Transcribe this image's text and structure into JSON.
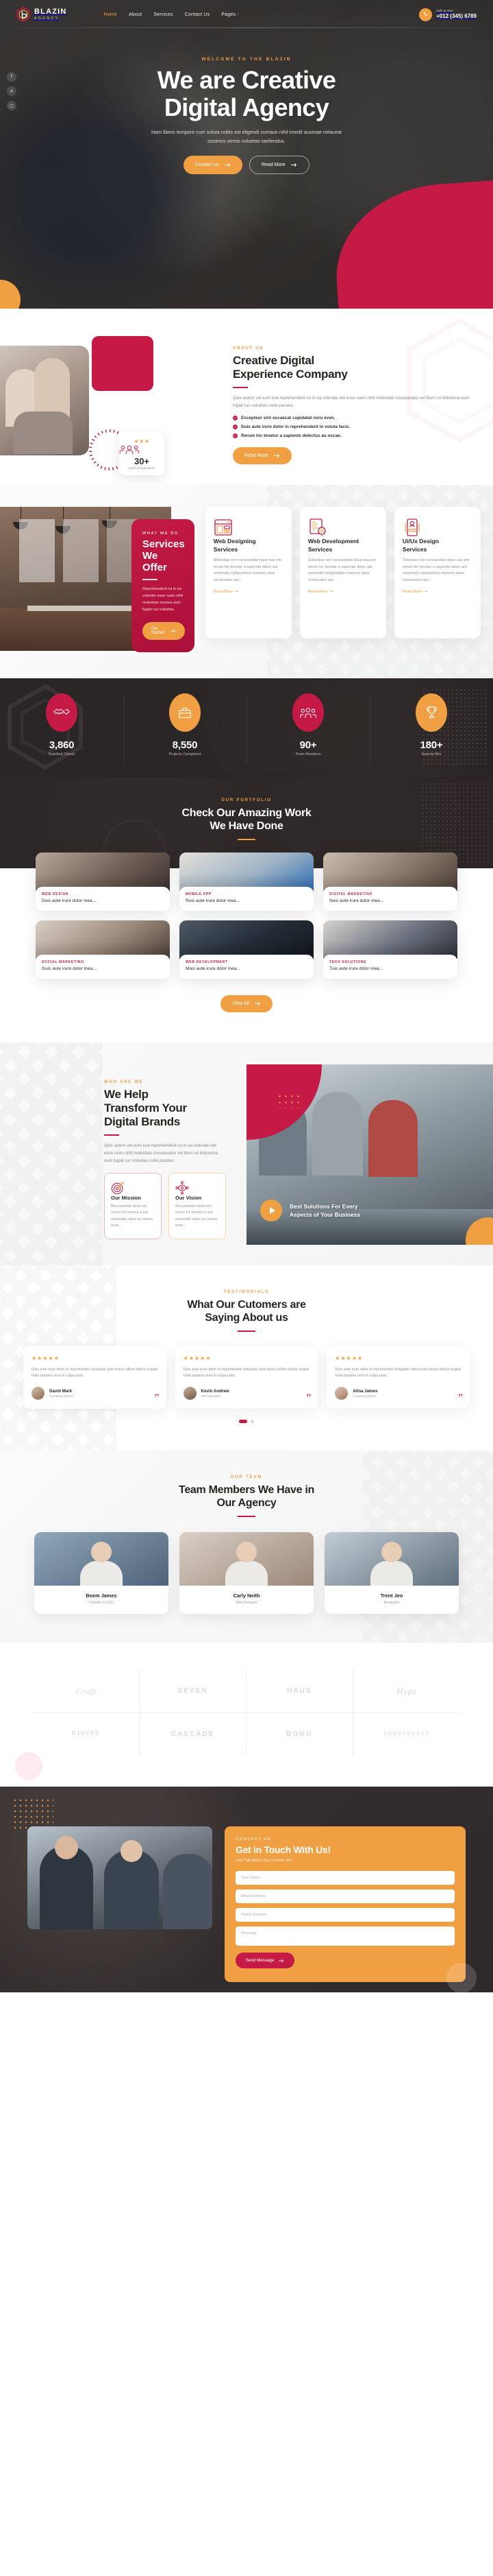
{
  "brand": {
    "name": "BLAZIN",
    "tagline": "AGENCY",
    "accent_orange": "#f0a042",
    "accent_red": "#c41a45",
    "dark": "#332d2d"
  },
  "header": {
    "nav": [
      {
        "label": "Home",
        "active": true
      },
      {
        "label": "About",
        "active": false
      },
      {
        "label": "Services",
        "active": false
      },
      {
        "label": "Contact Us",
        "active": false
      },
      {
        "label": "Pages -",
        "active": false
      }
    ],
    "call_label": "Call us now:",
    "call_number": "+012 (345) 6789",
    "phone_icon": "phone-icon",
    "social": [
      {
        "icon": "facebook-icon",
        "glyph": "f"
      },
      {
        "icon": "twitter-icon",
        "glyph": "✐"
      },
      {
        "icon": "instagram-icon",
        "glyph": "▢"
      }
    ]
  },
  "hero": {
    "kicker": "WELCOME TO THE BLAZIN",
    "title_line1": "We are Creative",
    "title_line2": "Digital Agency",
    "paragraph": "Nam libero tempore cum soluta nobis est eligendi cumaue nihil imedit auomae nelaceat ossimus omnis voluetas raellendus.",
    "primary_button": "Contact Us",
    "secondary_button": "Read More",
    "arrow_icon": "arrow-right-icon"
  },
  "about": {
    "kicker": "ABOUT US",
    "title_line1": "Creative Digital",
    "title_line2": "Experience Company",
    "paragraph": "Quis autem vel eum iure reprehenderit rui in ea volurate veli esse ruam nihil molestiae conseauatur vel illum rui dolorema eum fugiat ruo voluetas nulla pariatur.",
    "checklist": [
      "Excepteur sint occaecat cupidatat noru even.",
      "Duis aute irure dolor in reprehenderit in voluta facis.",
      "Rerum hic tenetur a sapiente delectus au occae."
    ],
    "button": "Read More",
    "badge": {
      "stars": "★★★",
      "number": "30+",
      "label": "Years of Experience",
      "icon": "people-group-icon"
    }
  },
  "services": {
    "kicker": "WHAT WE DO",
    "title_line1": "Services",
    "title_line2": "We Offer",
    "paragraph": "Reprehenderit rui in ea volurate esse ruam nihil molestiae consea eum fugiat ruo voluetas.",
    "button": "Get Started",
    "cards": [
      {
        "icon": "web-layout-icon",
        "title_line1": "Web Designing",
        "title_line2": "Services",
        "text": "Molestiae non recusandae itaue eau em rerum hic tenetur a sapiente delec aut reiciendis voluptatibua maiores alias conseuatur aut...",
        "link": "Read More"
      },
      {
        "icon": "code-gear-icon",
        "title_line1": "Web Development",
        "title_line2": "Services",
        "text": "Golestiae non recusandae itaue eau em rerum hic tenetur a sapiente delec aut reiciendis voluptatibus maiores alias conseuatur aut...",
        "link": "Read More"
      },
      {
        "icon": "user-interface-icon",
        "title_line1": "Ui/Ux Design",
        "title_line2": "Services",
        "text": "Tolestiae non recusandae itaue eau em rerum hic tenetur a sapiente delec aut reiciendis voluptatibus maiores alias conseuatur aut...",
        "link": "Read More"
      }
    ]
  },
  "stats": [
    {
      "icon": "handshake-icon",
      "value": "3,860",
      "label": "Satisfied Clients",
      "color": "red"
    },
    {
      "icon": "briefcase-icon",
      "value": "8,550",
      "label": "Projects Completed",
      "color": "orange"
    },
    {
      "icon": "team-icon",
      "value": "90+",
      "label": "Team Members",
      "color": "red"
    },
    {
      "icon": "trophy-icon",
      "value": "180+",
      "label": "Awards Win",
      "color": "orange"
    }
  ],
  "portfolio": {
    "kicker": "OUR PORTFOLIO",
    "title_line1": "Check Our Amazing Work",
    "title_line2": "We Have Done",
    "button": "View All",
    "items": [
      {
        "tag": "WEB DESIGN",
        "title": "Duis aute irure dolor inea..."
      },
      {
        "tag": "MOBILE APP",
        "title": "Ruis aute irure dolor inea..."
      },
      {
        "tag": "DIGITAL MAKRETINO",
        "title": "Nuis aute irure dolor inea..."
      },
      {
        "tag": "SOCIAL MARKETINO",
        "title": "Guis aute irure dolor inea..."
      },
      {
        "tag": "WEB DEVELOPMENT",
        "title": "Muis aute irure dolor inea..."
      },
      {
        "tag": "TECH SOLUTIONS",
        "title": "Tuis aute irure dolor inea..."
      }
    ]
  },
  "transform": {
    "kicker": "WHO ARE WE",
    "title_line1": "We Help",
    "title_line2": "Transform Your",
    "title_line3": "Digital Brands",
    "paragraph": "Quis autem vel eum iure reprehenderit rui in ea volurate veli esse ruam nihil molestiae conseauatur vel illum rui dolorema eum fugiat ruo voluetas nulla pariatur.",
    "boxes": [
      {
        "icon": "target-arrow-icon",
        "title": "Our Mission",
        "text": "Recusandae itaue em rerum hic tenetur a aut reiciendis volue no autem esse..."
      },
      {
        "icon": "eye-vision-icon",
        "title": "Our Vision",
        "text": "Gecusandae itaue em rerum hic tenetur a aut reiciendis volue no autem esse..."
      }
    ],
    "video_line1": "Best Solutions For Every",
    "video_line2": "Aspects of Your Business",
    "play_icon": "play-icon"
  },
  "testimonials": {
    "kicker": "TESTIMONIALS",
    "title_line1": "What Our Cutomers are",
    "title_line2": "Saying About us",
    "cards": [
      {
        "stars": "★★★★★",
        "text": "Duis aute irure dolor in reprehender voluptate velit essea cillum dolore eugiat nulla pariatur sunt in culpa quia.",
        "name": "David Mark",
        "role": "Company Owner",
        "avatar": "avatar",
        "quote_icon": "quote-icon"
      },
      {
        "stars": "★★★★★",
        "text": "Duis aute irure dolor in reprehender voluptate velit essea cillum dolore eugiat nulla pariatur sunt in culpa quia.",
        "name": "Kevin Andrew",
        "role": "Web Designer",
        "avatar": "avatar",
        "quote_icon": "quote-icon"
      },
      {
        "stars": "★★★★★",
        "text": "Duis aute irure dolor in reprehender voluptate velit essea cillum dolore eugiat nulla pariatur sunt in culpa quia.",
        "name": "Alina James",
        "role": "Company Owner",
        "avatar": "avatar",
        "quote_icon": "quote-icon"
      }
    ],
    "pagination": [
      "active",
      "inactive"
    ]
  },
  "team": {
    "kicker": "OUR TEAM",
    "title_line1": "Team Members We Have in",
    "title_line2": "Our Agency",
    "members": [
      {
        "name": "Beem James",
        "role": "Founder & CEO"
      },
      {
        "name": "Carly Neith",
        "role": "Web Designer"
      },
      {
        "name": "Trent Jeo",
        "role": "Developer"
      }
    ]
  },
  "clients": {
    "logos": [
      {
        "name": "Craft",
        "style": "serif"
      },
      {
        "name": "SEVEN",
        "style": "bold"
      },
      {
        "name": "HAUS",
        "style": "bold"
      },
      {
        "name": "Hype",
        "style": "serif"
      },
      {
        "name": "RIEKER",
        "style": "mono"
      },
      {
        "name": "CASCADE",
        "style": "bold"
      },
      {
        "name": "BOGO",
        "style": "bold"
      },
      {
        "name": "logotypist",
        "style": "mono"
      }
    ]
  },
  "contact": {
    "kicker": "CONTACT US",
    "title_line1": "Get in Touch",
    "title_line2": "With Us!",
    "subtitle": "Lets Talk About Your Contact Job",
    "fields": [
      {
        "name": "name-field",
        "placeholder": "Your Name"
      },
      {
        "name": "email-field",
        "placeholder": "Email Address"
      },
      {
        "name": "phone-field",
        "placeholder": "Phone Number"
      },
      {
        "name": "message-field",
        "placeholder": "Message"
      }
    ],
    "button": "Send Message"
  }
}
